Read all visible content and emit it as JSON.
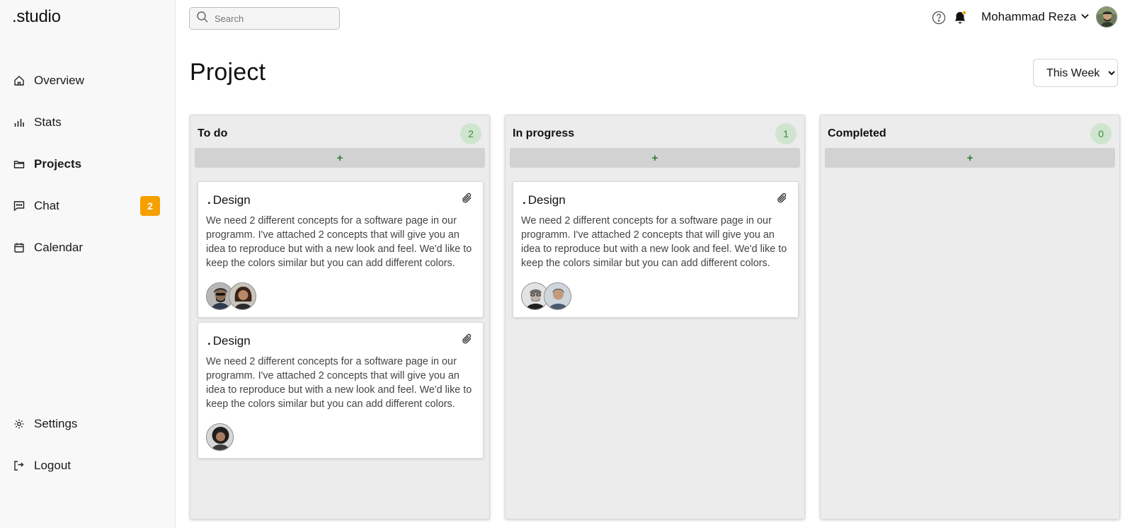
{
  "app": {
    "logo": ".studio"
  },
  "sidebar": {
    "items": [
      {
        "label": "Overview",
        "icon": "home-icon"
      },
      {
        "label": "Stats",
        "icon": "bar-chart-icon"
      },
      {
        "label": "Projects",
        "icon": "folder-icon",
        "active": true
      },
      {
        "label": "Chat",
        "icon": "chat-icon",
        "badge": "2"
      },
      {
        "label": "Calendar",
        "icon": "calendar-icon"
      }
    ],
    "bottom_items": [
      {
        "label": "Settings",
        "icon": "gear-icon"
      },
      {
        "label": "Logout",
        "icon": "logout-icon"
      }
    ]
  },
  "header": {
    "search": {
      "placeholder": "Search"
    },
    "user": {
      "name": "Mohammad Reza"
    }
  },
  "page": {
    "title": "Project",
    "period": {
      "selected": "This Week",
      "options": [
        "This Week"
      ]
    }
  },
  "colors": {
    "badge": "#f5a000",
    "count_bg": "#cfe5cf",
    "count_text": "#3a8a3a",
    "add_plus": "#2e7d32",
    "notification_dot": "#f5a000"
  },
  "board": {
    "columns": [
      {
        "title": "To do",
        "count": "2",
        "add_label": "+",
        "cards": [
          {
            "dot": ".",
            "title": "Design",
            "description": "We need 2 different concepts for a software page in our programm. I've attached 2 concepts that will give you an idea to reproduce but with a new look and feel. We'd like to keep the colors similar but you can add different colors.",
            "avatar_count": 2
          },
          {
            "dot": ".",
            "title": "Design",
            "description": "We need 2 different concepts for a software page in our programm. I've attached 2 concepts that will give you an idea to reproduce but with a new look and feel. We'd like to keep the colors similar but you can add different colors.",
            "avatar_count": 1
          }
        ]
      },
      {
        "title": "In progress",
        "count": "1",
        "add_label": "+",
        "cards": [
          {
            "dot": ".",
            "title": "Design",
            "description": "We need 2 different concepts for a software page in our programm. I've attached 2 concepts that will give you an idea to reproduce but with a new look and feel. We'd like to keep the colors similar but you can add different colors.",
            "avatar_count": 2
          }
        ]
      },
      {
        "title": "Completed",
        "count": "0",
        "add_label": "+",
        "cards": []
      }
    ]
  }
}
